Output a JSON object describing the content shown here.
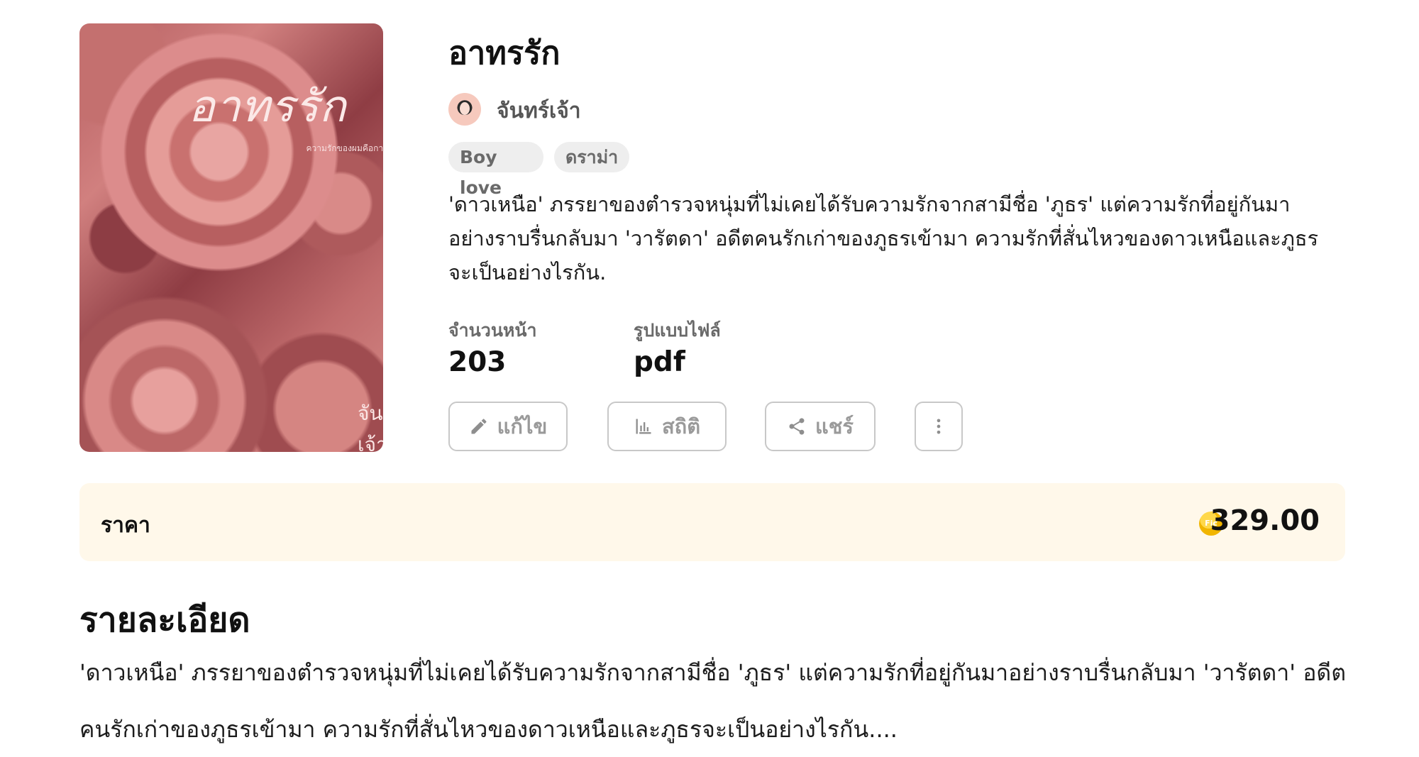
{
  "cover": {
    "title": "อาทรรัก",
    "tagline": "ความรักของผมคือการรอคอย",
    "author": "จันทร์เจ้า"
  },
  "book": {
    "title": "อาทรรัก",
    "author": "จันทร์เจ้า",
    "tags": [
      "Boy love",
      "ดราม่า"
    ],
    "synopsis": "'ดาวเหนือ' ภรรยาของตำรวจหนุ่มที่ไม่เคยได้รับความรักจากสามีชื่อ 'ภูธร' แต่ความรักที่อยู่กันมาอย่างราบรื่นกลับมา 'วารัตดา' อดีตคนรักเก่าของภูธรเข้ามา ความรักที่สั่นไหวของดาวเหนือและภูธรจะเป็นอย่างไรกัน."
  },
  "meta": {
    "pages_label": "จำนวนหน้า",
    "pages_value": "203",
    "format_label": "รูปแบบไฟล์",
    "format_value": "pdf"
  },
  "actions": {
    "edit": "แก้ไข",
    "stats": "สถิติ",
    "share": "แชร์"
  },
  "price": {
    "label": "ราคา",
    "coin_text": "Fic",
    "value": "329.00"
  },
  "details": {
    "heading": "รายละเอียด",
    "text": "'ดาวเหนือ' ภรรยาของตำรวจหนุ่มที่ไม่เคยได้รับความรักจากสามีชื่อ 'ภูธร' แต่ความรักที่อยู่กันมาอย่างราบรื่นกลับมา 'วารัตดา' อดีตคนรักเก่าของภูธรเข้ามา ความรักที่สั่นไหวของดาวเหนือและภูธรจะเป็นอย่างไรกัน...."
  },
  "icons": {
    "edit": "pencil-icon",
    "stats": "bar-chart-icon",
    "share": "share-icon",
    "more": "more-vertical-icon",
    "coin": "coin-icon"
  }
}
